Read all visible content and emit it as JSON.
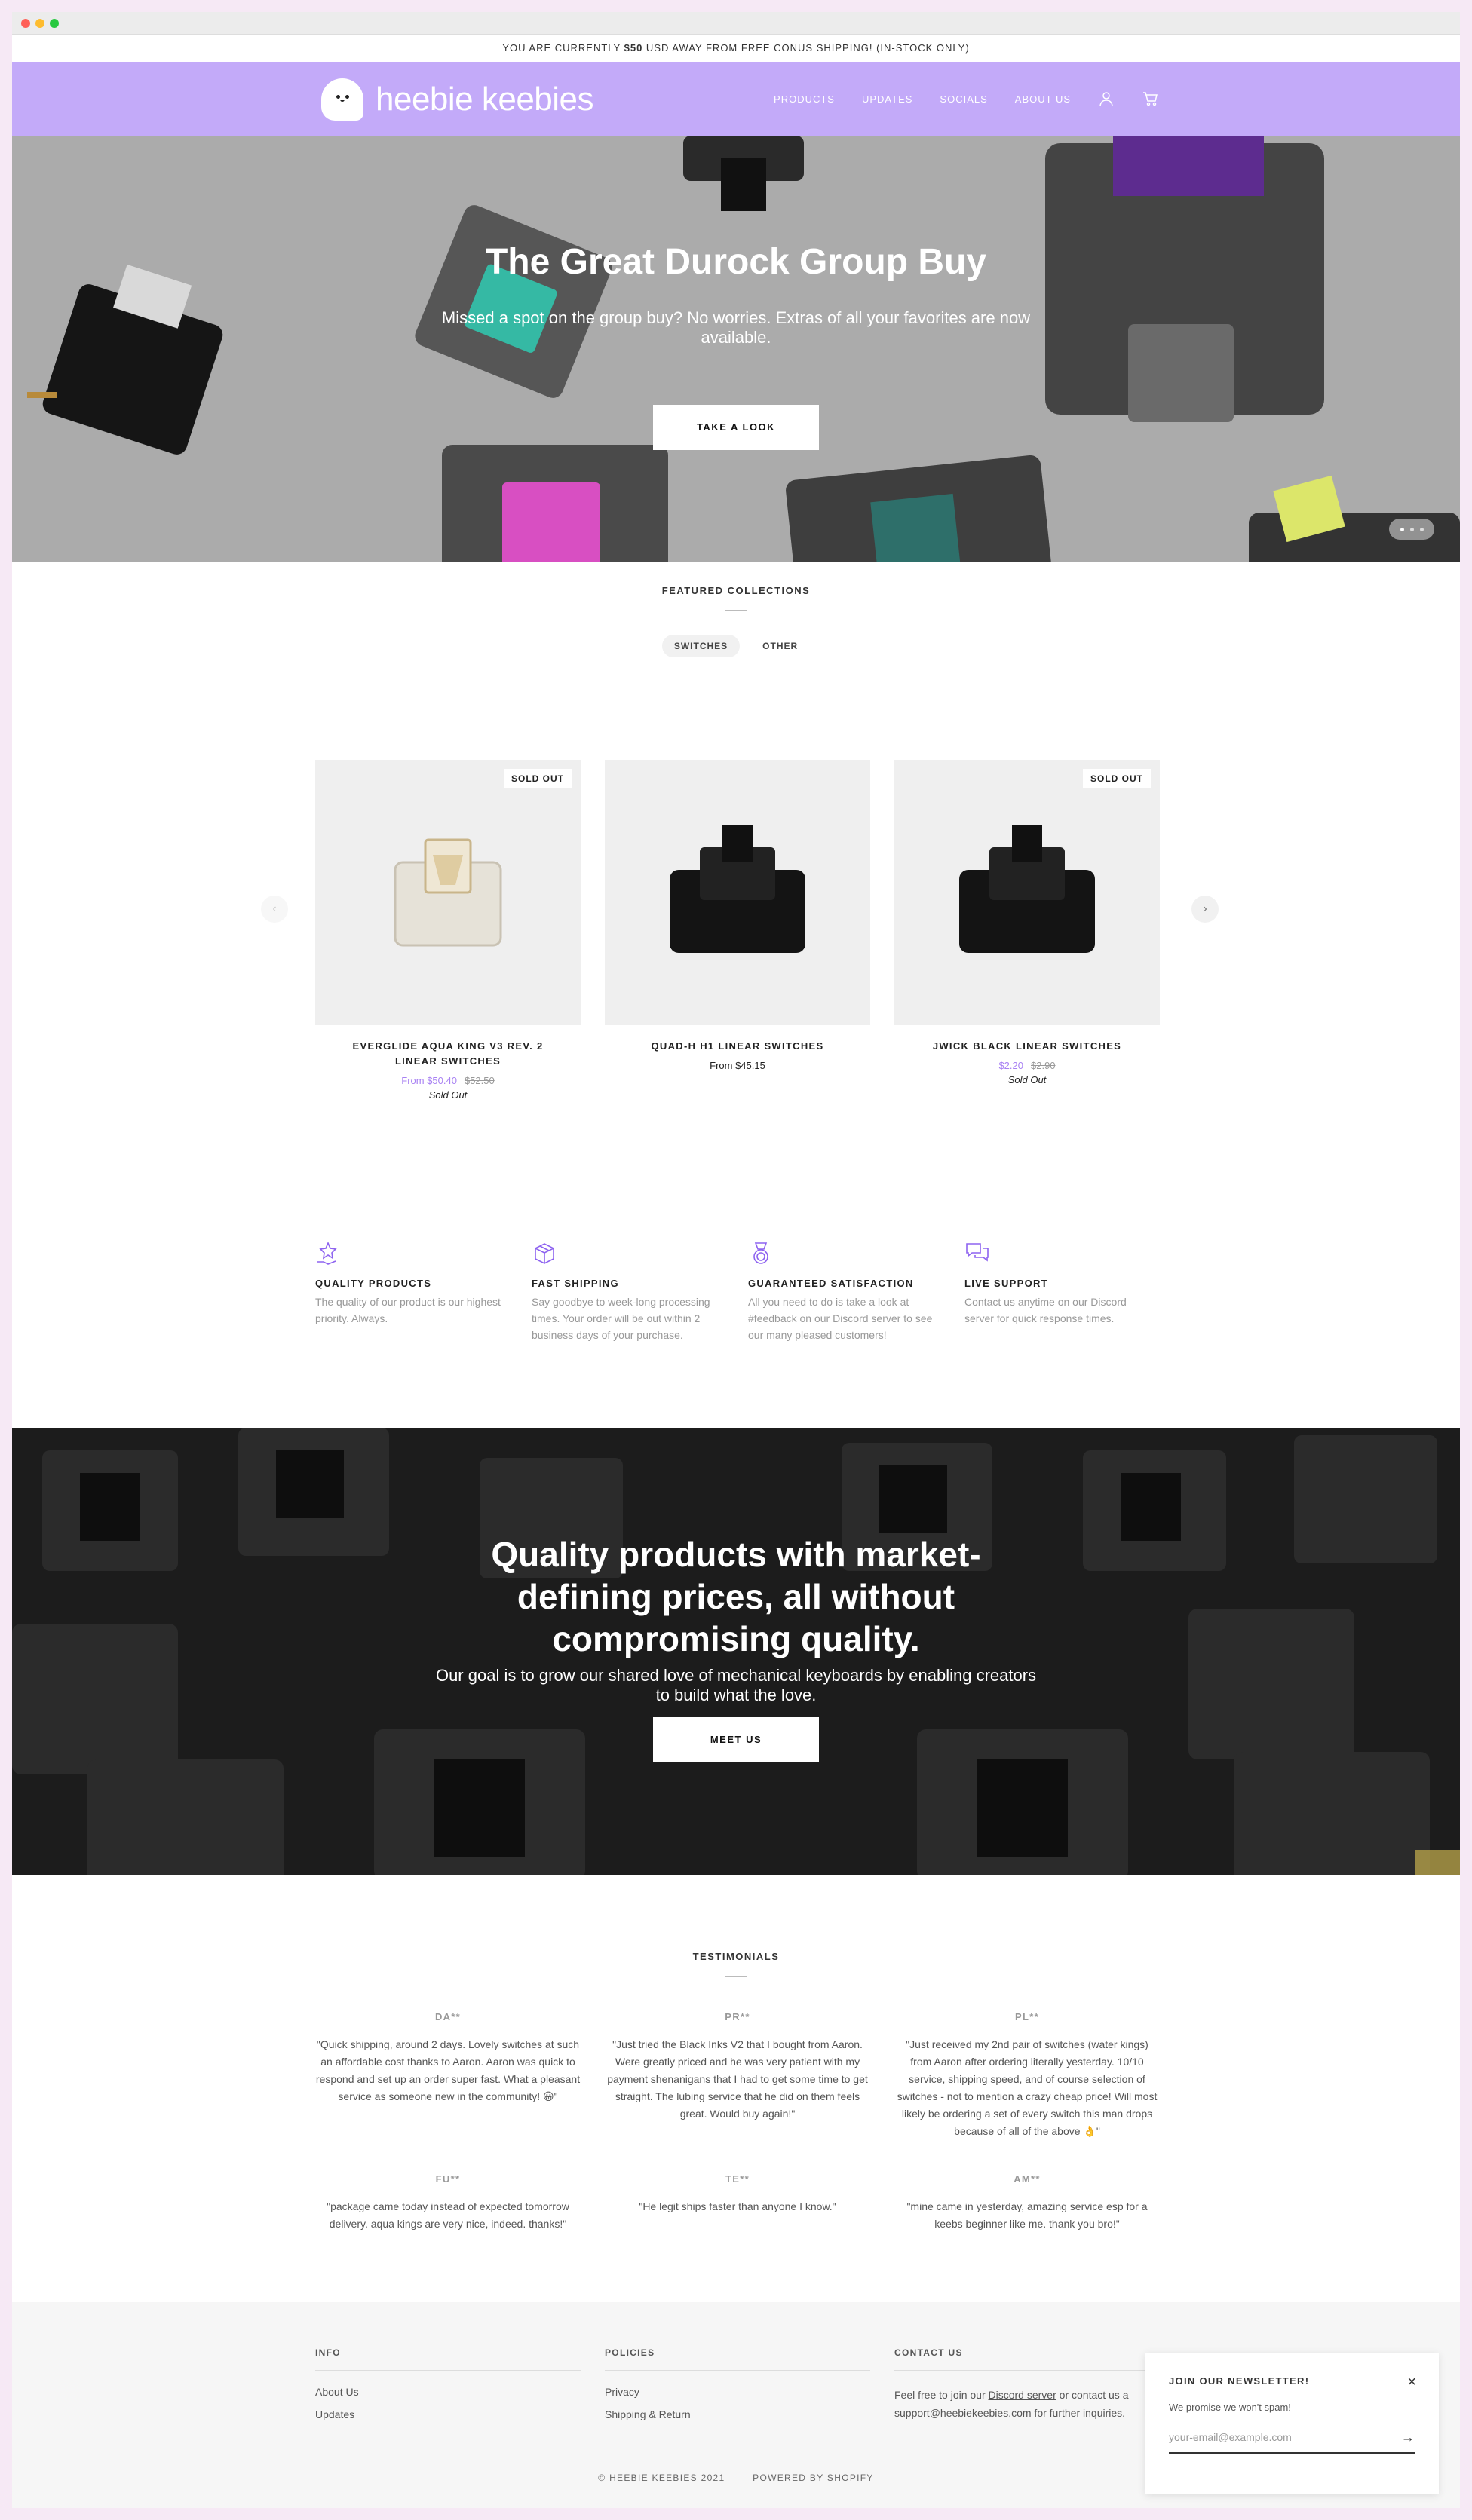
{
  "announcement": {
    "prefix": "YOU ARE CURRENTLY ",
    "amount": "$50",
    "suffix": " USD AWAY FROM FREE CONUS SHIPPING! (IN-STOCK ONLY)"
  },
  "header": {
    "brand": "heebie keebies",
    "nav": [
      "PRODUCTS",
      "UPDATES",
      "SOCIALS",
      "ABOUT US"
    ],
    "account_icon": "user-icon",
    "cart_icon": "cart-icon",
    "background": "#c3aaf9"
  },
  "hero": {
    "title": "The Great Durock Group Buy",
    "subtitle": "Missed a spot on the group buy? No worries. Extras of all your favorites are now available.",
    "button": "TAKE A LOOK",
    "slide_count": 3,
    "active_slide": 1
  },
  "featured": {
    "title": "FEATURED COLLECTIONS",
    "tabs": [
      "SWITCHES",
      "OTHER"
    ],
    "active_tab": "SWITCHES",
    "products": [
      {
        "name": "EVERGLIDE AQUA KING V3 REV. 2 LINEAR SWITCHES",
        "price": "From $50.40",
        "compare": "$52.50",
        "badge": "SOLD OUT",
        "status": "Sold Out"
      },
      {
        "name": "QUAD-H H1 LINEAR SWITCHES",
        "price": "From $45.15",
        "compare": "",
        "badge": "",
        "status": ""
      },
      {
        "name": "JWICK BLACK LINEAR SWITCHES",
        "price": "$2.20",
        "compare": "$2.90",
        "badge": "SOLD OUT",
        "status": "Sold Out"
      }
    ]
  },
  "features": [
    {
      "icon": "star-hand-icon",
      "title": "QUALITY PRODUCTS",
      "text": "The quality of our product is our highest priority. Always."
    },
    {
      "icon": "box-icon",
      "title": "FAST SHIPPING",
      "text": "Say goodbye to week-long processing times. Your order will be out within 2 business days of your purchase."
    },
    {
      "icon": "medal-icon",
      "title": "GUARANTEED SATISFACTION",
      "text": "All you need to do is take a look at #feedback on our Discord server to see our many pleased customers!"
    },
    {
      "icon": "chat-icon",
      "title": "LIVE SUPPORT",
      "text": "Contact us anytime on our Discord server for quick response times."
    }
  ],
  "about": {
    "title": "Quality products with market-defining prices, all without compromising quality.",
    "subtitle": "Our goal is to grow our shared love of mechanical keyboards by enabling creators to build what the love.",
    "button": "MEET US"
  },
  "testimonials": {
    "title": "TESTIMONIALS",
    "items": [
      {
        "name": "DA**",
        "quote": "\"Quick shipping, around 2 days. Lovely switches at such an affordable cost thanks to Aaron. Aaron was quick to respond and set up an order super fast. What a pleasant service as someone new in the community! 😀\""
      },
      {
        "name": "PR**",
        "quote": "\"Just tried the Black Inks V2 that I bought from Aaron. Were greatly priced and he was very patient with my payment shenanigans that I had to get some time to get straight. The lubing service that he did on them feels great. Would buy again!\""
      },
      {
        "name": "PL**",
        "quote": "\"Just received my 2nd pair of switches (water kings) from Aaron after ordering literally yesterday. 10/10 service, shipping speed, and of course selection of switches - not to mention a crazy cheap price! Will most likely be ordering a set of every switch this man drops because of all of the above 👌\""
      },
      {
        "name": "FU**",
        "quote": "\"package came today instead of expected tomorrow delivery. aqua kings are very nice, indeed. thanks!\""
      },
      {
        "name": "TE**",
        "quote": "\"He legit ships faster than anyone I know.\""
      },
      {
        "name": "AM**",
        "quote": "\"mine came in yesterday, amazing service esp for a keebs beginner like me. thank you bro!\""
      }
    ]
  },
  "footer": {
    "info": {
      "title": "INFO",
      "links": [
        "About Us",
        "Updates"
      ]
    },
    "policies": {
      "title": "POLICIES",
      "links": [
        "Privacy",
        "Shipping & Return"
      ]
    },
    "contact": {
      "title": "CONTACT US",
      "line1_prefix": "Feel free to join our ",
      "line1_link": "Discord server",
      "line1_suffix": " or contact us a",
      "line2": "support@heebiekeebies.com for further inquiries."
    },
    "copyright": "© HEEBIE KEEBIES 2021",
    "powered": "POWERED BY SHOPIFY"
  },
  "newsletter": {
    "title": "JOIN OUR NEWSLETTER!",
    "subtitle": "We promise we won't spam!",
    "placeholder": "your-email@example.com",
    "close": "×",
    "submit": "→"
  },
  "colors": {
    "accent": "#a881f3",
    "header": "#c3aaf9",
    "footer_bg": "#f6f6f6"
  }
}
